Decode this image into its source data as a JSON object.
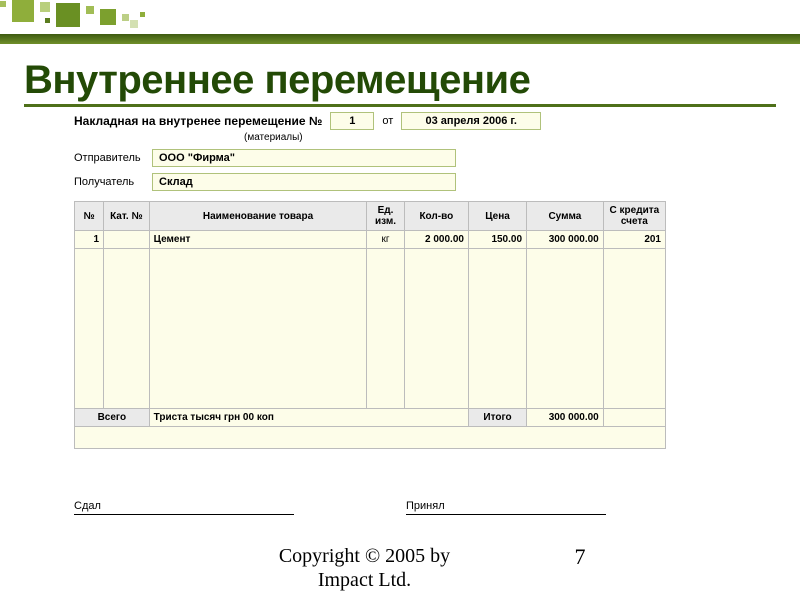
{
  "title": "Внутреннее перемещение",
  "invoice": {
    "header_label": "Накладная на внутренее перемещение №",
    "number": "1",
    "from_label": "от",
    "date": "03 апреля 2006 г.",
    "materials": "(материалы)",
    "sender_label": "Отправитель",
    "sender": "ООО \"Фирма\"",
    "receiver_label": "Получатель",
    "receiver": "Склад"
  },
  "columns": {
    "no": "№",
    "cat": "Кат. №",
    "name": "Наименование товара",
    "unit": "Ед. изм.",
    "qty": "Кол-во",
    "price": "Цена",
    "sum": "Сумма",
    "credit": "С кредита счета"
  },
  "rows": [
    {
      "no": "1",
      "cat": "",
      "name": "Цемент",
      "unit": "кг",
      "qty": "2 000.00",
      "price": "150.00",
      "sum": "300 000.00",
      "credit": "201"
    }
  ],
  "totals": {
    "vsego_label": "Всего",
    "words": "Триста тысяч грн 00 коп",
    "itogo_label": "Итого",
    "itogo_value": "300 000.00"
  },
  "sign": {
    "gave": "Сдал",
    "took": "Принял"
  },
  "footer": {
    "copyright_line1": "Copyright © 2005 by",
    "copyright_line2": "Impact Ltd.",
    "page": "7"
  }
}
